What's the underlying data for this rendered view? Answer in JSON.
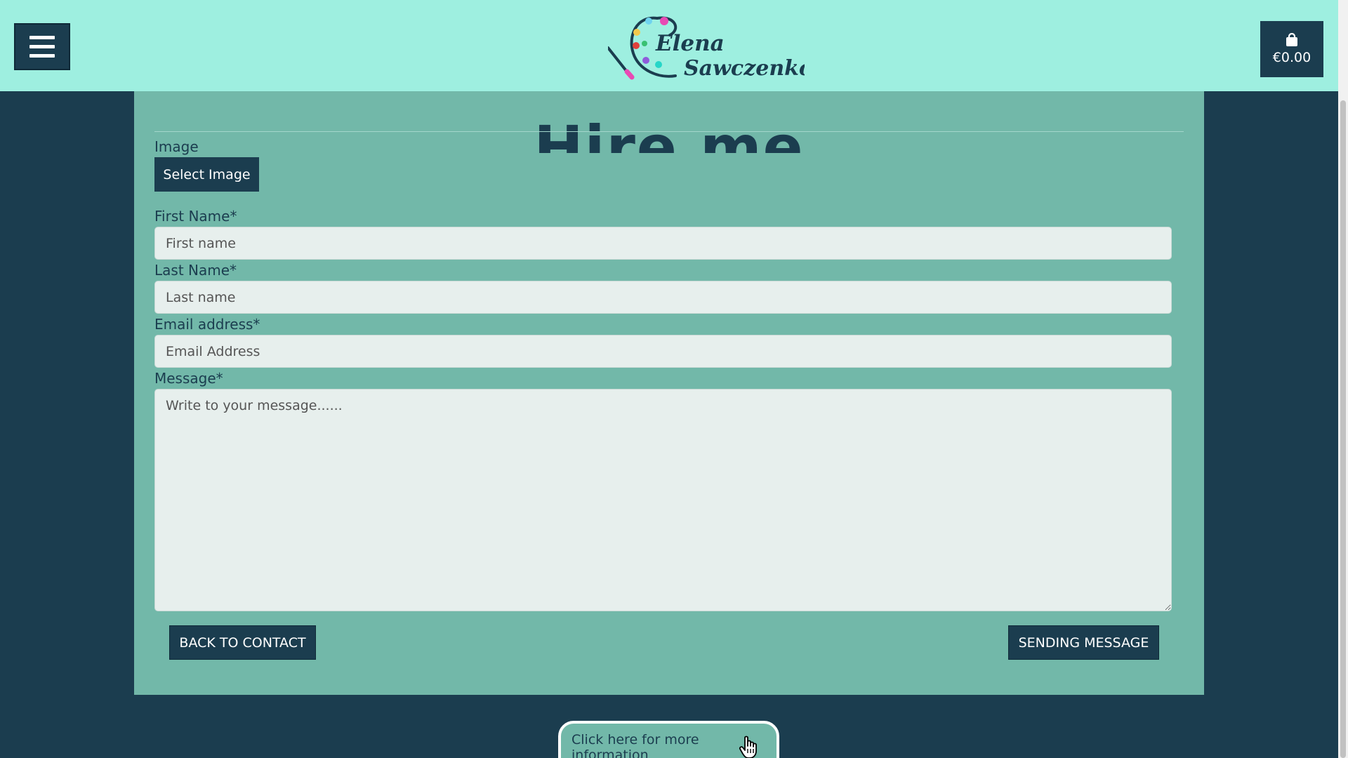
{
  "header": {
    "brand_line1": "Elena",
    "brand_line2": "Sawczenko",
    "cart_total": "€0.00"
  },
  "form": {
    "heading_partial": "Hire me",
    "image_label": "Image",
    "select_image_label": "Select Image",
    "first_name_label": "First Name*",
    "first_name_placeholder": "First name",
    "last_name_label": "Last Name*",
    "last_name_placeholder": "Last name",
    "email_label": "Email address*",
    "email_placeholder": "Email Address",
    "message_label": "Message*",
    "message_placeholder": "Write to your message......",
    "back_button": "BACK TO CONTACT",
    "send_button": "SENDING MESSAGE"
  },
  "footer": {
    "info_tab_label": "Click here for more information"
  },
  "colors": {
    "header_bg": "#9eefe0",
    "page_bg": "#1b3d4f",
    "panel_bg": "#72b8a9",
    "input_bg": "#e7efed"
  },
  "icons": {
    "menu": "hamburger-icon",
    "cart": "shopping-bag-icon",
    "logo": "palette-icon",
    "cursor": "hand-pointer-icon"
  }
}
